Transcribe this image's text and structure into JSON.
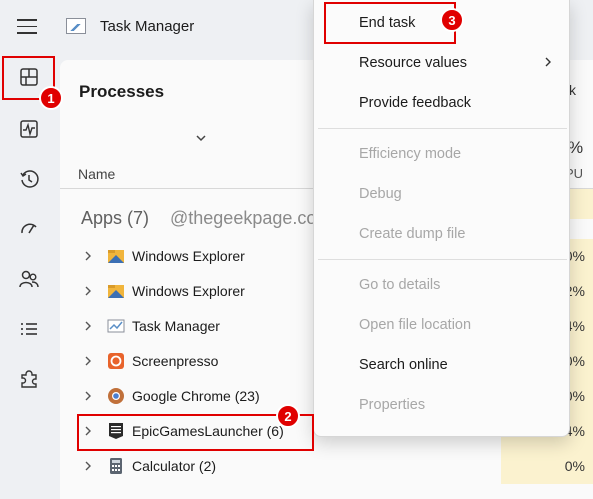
{
  "window": {
    "title": "Task Manager"
  },
  "nav": {
    "items": [
      {
        "id": "processes",
        "icon": "processes-icon"
      },
      {
        "id": "performance",
        "icon": "performance-icon"
      },
      {
        "id": "app-history",
        "icon": "app-history-icon"
      },
      {
        "id": "startup-apps",
        "icon": "startup-speedometer-icon"
      },
      {
        "id": "users",
        "icon": "users-icon"
      },
      {
        "id": "details",
        "icon": "details-list-icon"
      },
      {
        "id": "services",
        "icon": "services-puzzle-icon"
      }
    ]
  },
  "main": {
    "heading": "Processes",
    "name_column": "Name",
    "cpu_header_pct": "%",
    "cpu_header_label": "PU",
    "right_header_fragment": "k",
    "group_label": "Apps (7)",
    "watermark": "@thegeekpage.com",
    "rows": [
      {
        "name": "Windows Explorer",
        "cpu": "0%",
        "icon": "folder-icon"
      },
      {
        "name": "Windows Explorer",
        "cpu": "2%",
        "icon": "folder-icon"
      },
      {
        "name": "Task Manager",
        "cpu": "4%",
        "icon": "task-manager-icon"
      },
      {
        "name": "Screenpresso",
        "cpu": "0%",
        "icon": "screenpresso-icon"
      },
      {
        "name": "Google Chrome (23)",
        "cpu": "0%",
        "icon": "chrome-icon"
      },
      {
        "name": "EpicGamesLauncher (6)",
        "cpu": "4%",
        "icon": "epic-games-icon"
      },
      {
        "name": "Calculator (2)",
        "cpu": "0%",
        "icon": "calculator-icon"
      }
    ]
  },
  "context_menu": {
    "items": [
      {
        "label": "End task",
        "enabled": true
      },
      {
        "label": "Resource values",
        "enabled": true,
        "submenu": true
      },
      {
        "label": "Provide feedback",
        "enabled": true
      },
      {
        "label": "Efficiency mode",
        "enabled": false
      },
      {
        "label": "Debug",
        "enabled": false
      },
      {
        "label": "Create dump file",
        "enabled": false
      },
      {
        "label": "Go to details",
        "enabled": false
      },
      {
        "label": "Open file location",
        "enabled": false
      },
      {
        "label": "Search online",
        "enabled": true
      },
      {
        "label": "Properties",
        "enabled": false
      }
    ]
  },
  "annotations": {
    "badges": [
      "1",
      "2",
      "3"
    ],
    "color": "#e00000"
  },
  "colors": {
    "cpu_highlight": "#fbf2cf",
    "background": "#eef0f3"
  }
}
